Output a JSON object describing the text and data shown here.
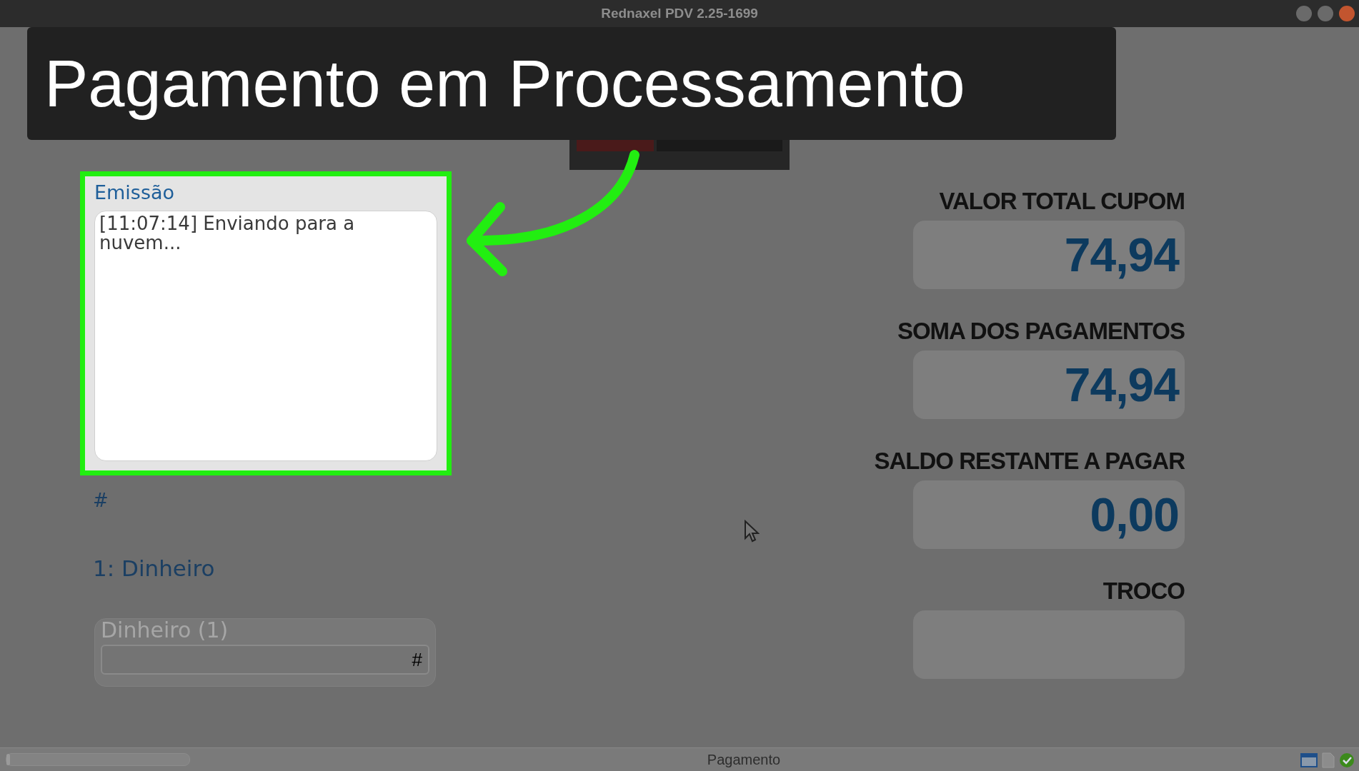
{
  "window": {
    "title": "Rednaxel PDV 2.25-1699"
  },
  "banner": {
    "text": "Pagamento em Processamento"
  },
  "emission": {
    "title": "Emissão",
    "highlighted": true,
    "log": "[11:07:14] Enviando para a nuvem..."
  },
  "payment_number": {
    "label": "#"
  },
  "payment_method": {
    "label": "1: Dinheiro"
  },
  "payment_field": {
    "legend": "Dinheiro (1)",
    "suffix": "#",
    "disabled": true
  },
  "totals": [
    {
      "label": "VALOR TOTAL CUPOM",
      "value": "74,94"
    },
    {
      "label": "SOMA DOS PAGAMENTOS",
      "value": "74,94"
    },
    {
      "label": "SALDO RESTANTE A PAGAR",
      "value": "0,00"
    },
    {
      "label": "TROCO"
    }
  ],
  "status_bar": {
    "text": "Pagamento",
    "progress": {
      "level": 0.02
    }
  }
}
